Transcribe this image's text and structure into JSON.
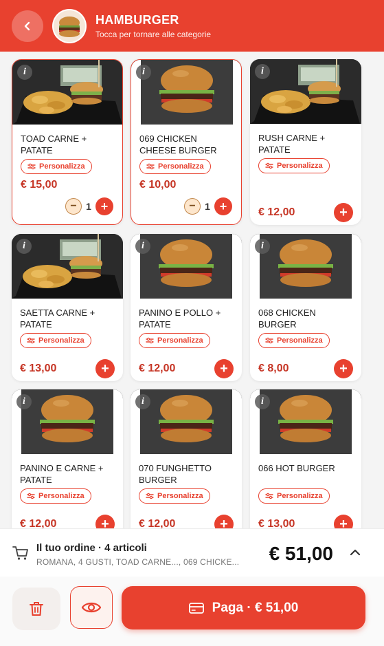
{
  "header": {
    "title": "HAMBURGER",
    "subtitle": "Tocca per tornare alle categorie"
  },
  "colors": {
    "accent": "#e8412f",
    "price": "#c63525"
  },
  "icons": {
    "back": "chevron-left-icon",
    "info": "info-icon",
    "personalize": "sliders-icon",
    "add": "plus-icon",
    "minus": "minus-icon",
    "cart": "cart-icon",
    "expand": "chevron-up-icon",
    "trash": "trash-icon",
    "eye": "eye-icon",
    "card": "credit-card-icon"
  },
  "products": [
    {
      "name": "TOAD CARNE + PATATE",
      "price": "€ 15,00",
      "quantity": "1",
      "selected": true,
      "image": "fries"
    },
    {
      "name": "069 CHICKEN CHEESE BURGER",
      "price": "€ 10,00",
      "quantity": "1",
      "selected": true,
      "image": "burger"
    },
    {
      "name": "RUSH CARNE + PATATE",
      "price": "€ 12,00",
      "quantity": null,
      "selected": false,
      "image": "fries"
    },
    {
      "name": "SAETTA CARNE + PATATE",
      "price": "€ 13,00",
      "quantity": null,
      "selected": false,
      "image": "fries"
    },
    {
      "name": "PANINO E POLLO + PATATE",
      "price": "€ 12,00",
      "quantity": null,
      "selected": false,
      "image": "burger"
    },
    {
      "name": "068 CHICKEN BURGER",
      "price": "€ 8,00",
      "quantity": null,
      "selected": false,
      "image": "burger"
    },
    {
      "name": "PANINO E CARNE + PATATE",
      "price": "€ 12,00",
      "quantity": null,
      "selected": false,
      "image": "burger"
    },
    {
      "name": "070 FUNGHETTO BURGER",
      "price": "€ 12,00",
      "quantity": null,
      "selected": false,
      "image": "burger"
    },
    {
      "name": "066 HOT BURGER",
      "price": "€ 13,00",
      "quantity": null,
      "selected": false,
      "image": "burger"
    }
  ],
  "personalize_label": "Personalizza",
  "info_glyph": "i",
  "order": {
    "title": "Il tuo ordine · 4 articoli",
    "summary": "ROMANA, 4 GUSTI, TOAD CARNE..., 069 CHICKE...",
    "total": "€ 51,00"
  },
  "actions": {
    "pay_label": "Paga · € 51,00"
  }
}
